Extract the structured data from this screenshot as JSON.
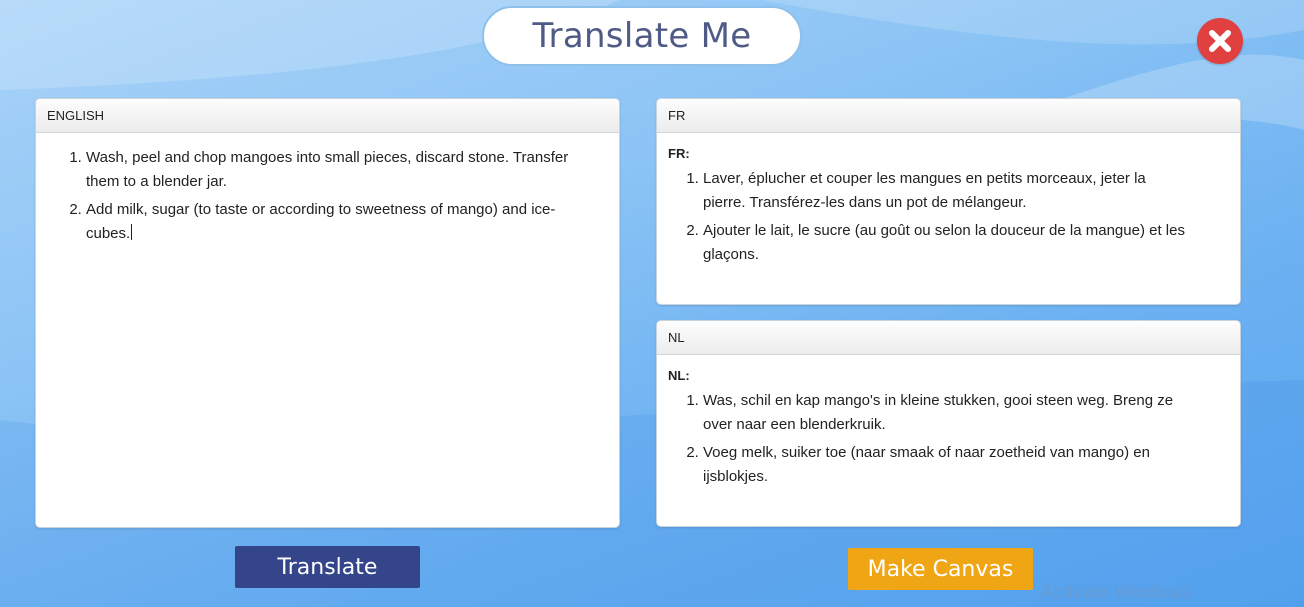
{
  "app": {
    "title": "Translate Me"
  },
  "colors": {
    "background": "#7ebcf4",
    "title_text": "#4f5a86",
    "close_button": "#e0403f",
    "translate_button": "#344689",
    "make_canvas_button": "#f0a614"
  },
  "icons": {
    "close": "close-x-circle"
  },
  "input_panel": {
    "header": "ENGLISH",
    "items": [
      "Wash, peel and chop mangoes into small pieces, discard stone. Transfer them to a blender jar.",
      "Add milk, sugar (to taste or according to sweetness of mango) and ice-cubes."
    ]
  },
  "output_panels": {
    "fr": {
      "header": "FR",
      "label": "FR:",
      "items": [
        "Laver, éplucher et couper les mangues en petits morceaux, jeter la pierre. Transférez-les dans un pot de mélangeur.",
        "Ajouter le lait, le sucre (au goût ou selon la douceur de la mangue) et les glaçons."
      ]
    },
    "nl": {
      "header": "NL",
      "label": "NL:",
      "items": [
        "Was, schil en kap mango's in kleine stukken, gooi steen weg. Breng ze over naar een blenderkruik.",
        "Voeg melk, suiker toe (naar smaak of naar zoetheid van mango) en ijsblokjes."
      ]
    }
  },
  "buttons": {
    "translate": "Translate",
    "make_canvas": "Make Canvas"
  },
  "watermark": "Activate Windows"
}
